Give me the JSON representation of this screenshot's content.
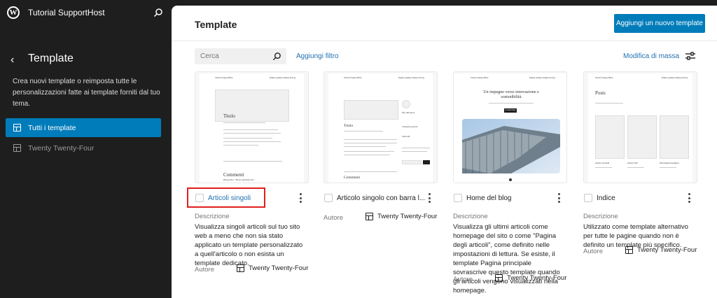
{
  "sidebar": {
    "site_name": "Tutorial SupportHost",
    "title": "Template",
    "description": "Crea nuovi template o reimposta tutte le personalizzazioni fatte ai template forniti dal tuo tema.",
    "nav": [
      {
        "label": "Tutti i template",
        "active": true
      },
      {
        "label": "Twenty Twenty-Four",
        "active": false
      }
    ]
  },
  "main": {
    "title": "Template",
    "add_button": "Aggiungi un nuovo template",
    "search_placeholder": "Cerca",
    "filter_link": "Aggiungi filtro",
    "bulk_link": "Modifica di massa",
    "description_label": "Descrizione",
    "author_label": "Autore"
  },
  "preview_text": {
    "site": "Tutorial SupportHost",
    "nav": "Pagina esempio   Pagina di blog",
    "post_title": "Titolo",
    "comments": "Commenti",
    "respond": "Rispondi a \"Titolo dell'articolo\"",
    "sidebar_about": "Info sull'autore",
    "sidebar_popular": "Categorie popolari",
    "sidebar_links": "Link utili",
    "hero": "Un impegno verso innovazione e sostenibilità",
    "hero_button": "Il nostro blog",
    "posts": "Posts",
    "post_cards": [
      "Guida Jornada",
      "Guida WP",
      "Newsletter/esempio"
    ]
  },
  "cards": [
    {
      "title": "Articoli singoli",
      "description": "Visualizza singoli articoli sul tuo sito web a meno che non sia stato applicato un template personalizzato a quell'articolo o non esista un template dedicato.",
      "author": "Twenty Twenty-Four",
      "highlighted": true
    },
    {
      "title": "Articolo singolo con barra l...",
      "description": "",
      "author": "Twenty Twenty-Four",
      "highlighted": false
    },
    {
      "title": "Home del blog",
      "description": "Visualizza gli ultimi articoli come homepage del sito o come \"Pagina degli articoli\", come definito nelle impostazioni di lettura. Se esiste, il template Pagina principale sovrascrive questo template quando gli articoli vengono visualizzati nella homepage.",
      "author": "Twenty Twenty-Four",
      "highlighted": false
    },
    {
      "title": "Indice",
      "description": "Utilizzato come template alternativo per tutte le pagine quando non è definito un template più specifico.",
      "author": "Twenty Twenty-Four",
      "highlighted": false
    }
  ],
  "colors": {
    "accent": "#007cba",
    "link": "#2271b1",
    "highlight": "#e0201c",
    "sidebar_bg": "#1e1e1e"
  },
  "icons": [
    "wordpress-icon",
    "search-icon",
    "back-arrow-icon",
    "layout-icon",
    "sliders-icon",
    "more-vertical-icon"
  ]
}
